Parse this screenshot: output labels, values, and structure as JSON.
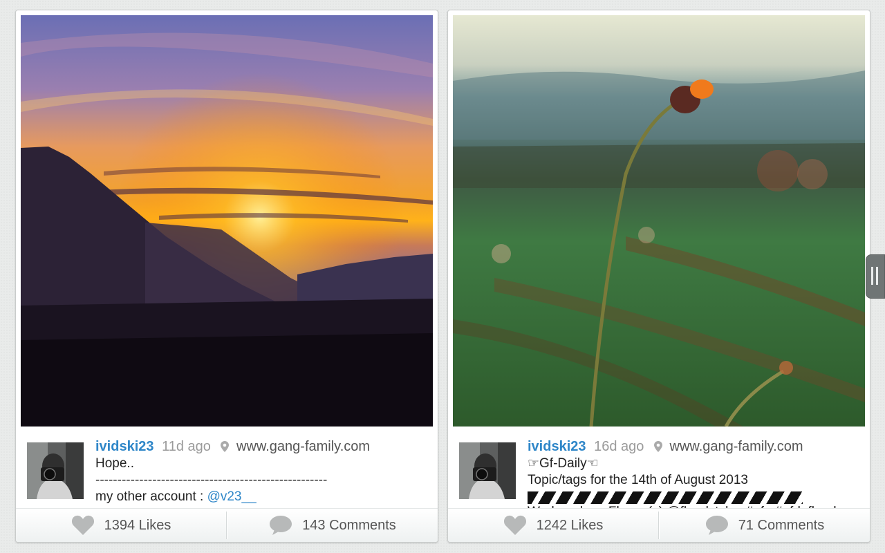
{
  "posts": [
    {
      "username": "ividski23",
      "time_ago": "11d ago",
      "location": "www.gang-family.com",
      "caption_lines": [
        "Hope..",
        "-----------------------------------------------------"
      ],
      "caption_prefix": "my other account : ",
      "caption_mention": "@v23__",
      "likes": "1394 Likes",
      "comments": "143 Comments",
      "photo_subject": "mountain-sunset"
    },
    {
      "username": "ividski23",
      "time_ago": "16d ago",
      "location": "www.gang-family.com",
      "caption_lines": [
        "☞Gf-Daily☜",
        "Topic/tags for the 14th of August 2013"
      ],
      "caption_cut": "Wednesday - Flower(s) @floralstyles #gf_ #gfd_floral",
      "likes": "1242 Likes",
      "comments": "71 Comments",
      "photo_subject": "flower-field"
    }
  ],
  "icons": {
    "like": "heart-icon",
    "comment": "speech-bubble-icon",
    "location": "map-pin-icon",
    "drawer": "drawer-handle-icon"
  },
  "colors": {
    "username": "#2e86c8",
    "time": "#9a9a9a"
  }
}
